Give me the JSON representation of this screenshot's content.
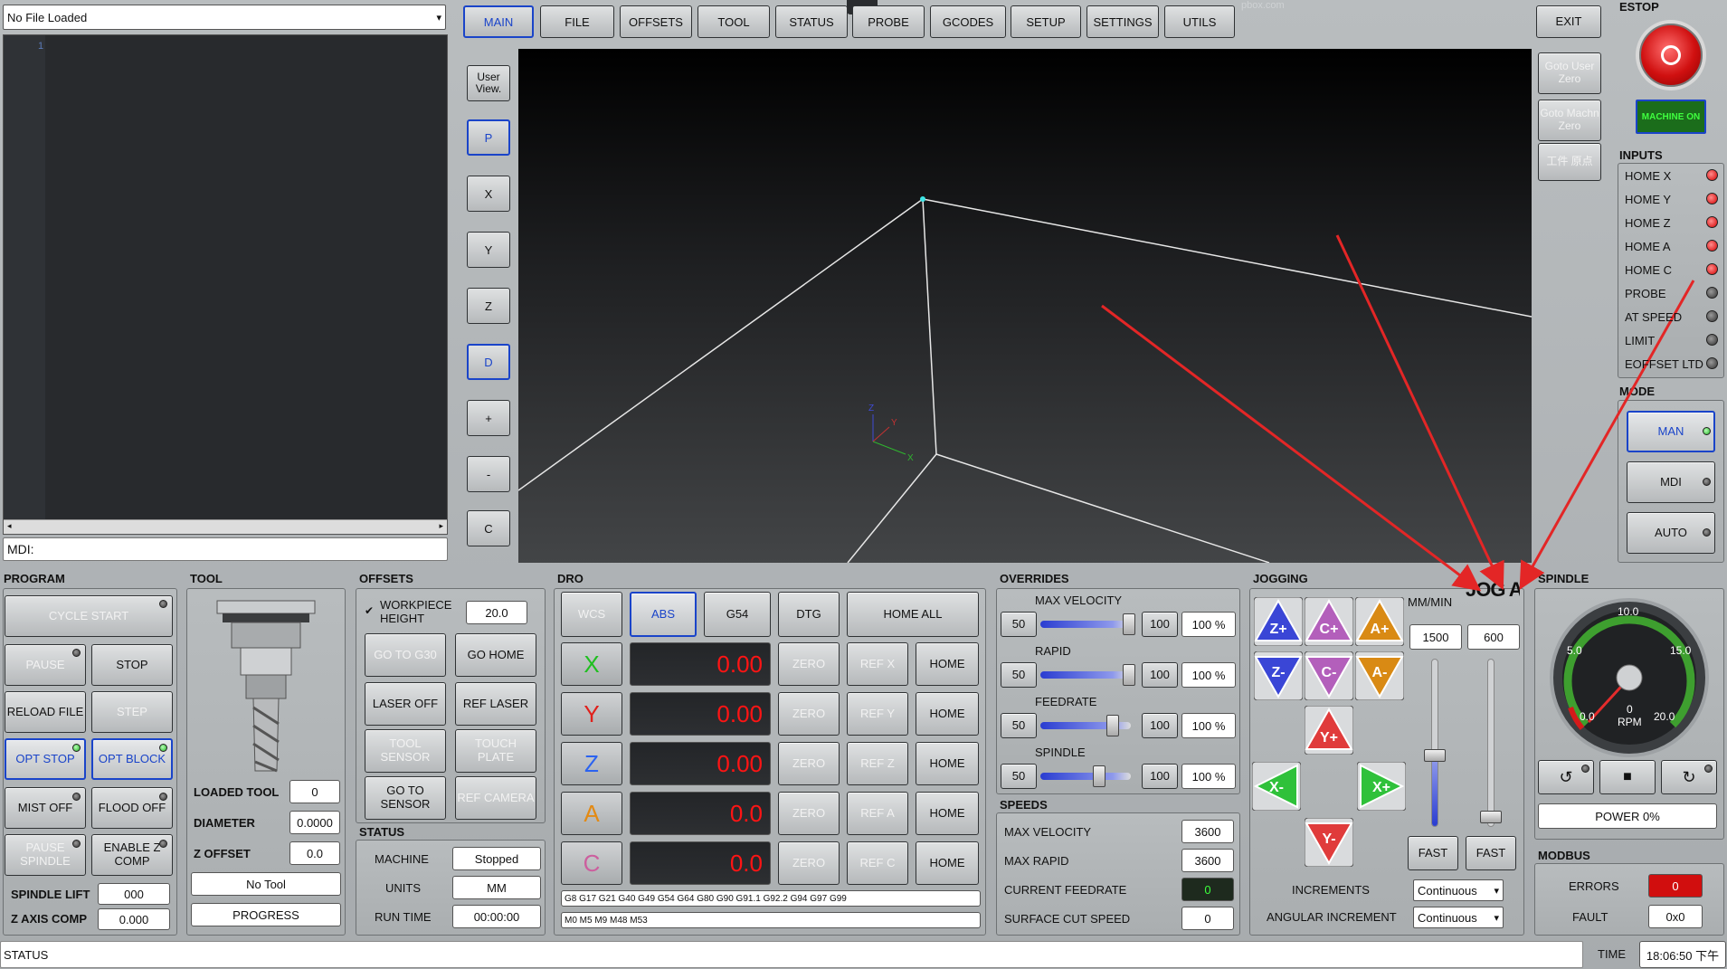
{
  "file_combo": {
    "value": "No File Loaded"
  },
  "editor": {
    "line": "1"
  },
  "mdi": {
    "label": "MDI:"
  },
  "tabs": [
    {
      "label": "MAIN"
    },
    {
      "label": "FILE"
    },
    {
      "label": "OFFSETS"
    },
    {
      "label": "TOOL"
    },
    {
      "label": "STATUS"
    },
    {
      "label": "PROBE"
    },
    {
      "label": "GCODES"
    },
    {
      "label": "SETUP"
    },
    {
      "label": "SETTINGS"
    },
    {
      "label": "UTILS"
    }
  ],
  "exit_label": "EXIT",
  "watermark": "pbox.com",
  "view_buttons": [
    {
      "label": "User View."
    },
    {
      "label": "P"
    },
    {
      "label": "X"
    },
    {
      "label": "Y"
    },
    {
      "label": "Z"
    },
    {
      "label": "D"
    },
    {
      "label": "+"
    },
    {
      "label": "-"
    },
    {
      "label": "C"
    }
  ],
  "goto_buttons": [
    {
      "label": "Goto User Zero"
    },
    {
      "label": "Goto Machn Zero"
    },
    {
      "label": "工件 原点"
    }
  ],
  "estop": {
    "title": "ESTOP",
    "machine_on": "MACHINE ON"
  },
  "inputs": {
    "title": "INPUTS",
    "items": [
      {
        "label": "HOME X",
        "state": "red"
      },
      {
        "label": "HOME Y",
        "state": "red"
      },
      {
        "label": "HOME Z",
        "state": "red"
      },
      {
        "label": "HOME A",
        "state": "red"
      },
      {
        "label": "HOME C",
        "state": "red"
      },
      {
        "label": "PROBE",
        "state": "off"
      },
      {
        "label": "AT SPEED",
        "state": "off"
      },
      {
        "label": "LIMIT",
        "state": "off"
      },
      {
        "label": "EOFFSET LTD",
        "state": "off"
      }
    ]
  },
  "mode": {
    "title": "MODE",
    "items": [
      {
        "label": "MAN"
      },
      {
        "label": "MDI"
      },
      {
        "label": "AUTO"
      }
    ]
  },
  "program": {
    "title": "PROGRAM",
    "cycle_start": "CYCLE START",
    "pause": "PAUSE",
    "stop": "STOP",
    "reload": "RELOAD FILE",
    "step": "STEP",
    "opt_stop": "OPT STOP",
    "opt_block": "OPT BLOCK",
    "mist": "MIST OFF",
    "flood": "FLOOD OFF",
    "pause_spindle": "PAUSE SPINDLE",
    "enable_z": "ENABLE Z COMP",
    "spindle_lift_label": "SPINDLE LIFT",
    "spindle_lift": "000",
    "z_axis_comp_label": "Z AXIS COMP",
    "z_axis_comp": "0.000"
  },
  "tool": {
    "title": "TOOL",
    "loaded_tool_label": "LOADED TOOL",
    "loaded_tool": "0",
    "diameter_label": "DIAMETER",
    "diameter": "0.0000",
    "z_offset_label": "Z OFFSET",
    "z_offset": "0.0",
    "no_tool": "No Tool",
    "progress": "PROGRESS"
  },
  "offsets": {
    "title": "OFFSETS",
    "workpiece_label": "WORKPIECE HEIGHT",
    "workpiece": "20.0",
    "go_to_g30": "GO TO G30",
    "go_home": "GO HOME",
    "laser_off": "LASER OFF",
    "ref_laser": "REF LASER",
    "tool_sensor": "TOOL SENSOR",
    "touch_plate": "TOUCH PLATE",
    "go_to_sensor": "GO TO SENSOR",
    "ref_camera": "REF CAMERA"
  },
  "status": {
    "title": "STATUS",
    "machine_label": "MACHINE",
    "machine": "Stopped",
    "units_label": "UNITS",
    "units": "MM",
    "run_time_label": "RUN TIME",
    "run_time": "00:00:00"
  },
  "dro": {
    "title": "DRO",
    "wcs": "WCS",
    "abs": "ABS",
    "g54": "G54",
    "dtg": "DTG",
    "home_all": "HOME ALL",
    "axes": [
      {
        "name": "X",
        "value": "0.00",
        "color": "#1fbf1f",
        "zero": "ZERO",
        "ref": "REF X",
        "home": "HOME"
      },
      {
        "name": "Y",
        "value": "0.00",
        "color": "#e0201b",
        "zero": "ZERO",
        "ref": "REF Y",
        "home": "HOME"
      },
      {
        "name": "Z",
        "value": "0.00",
        "color": "#2b63f0",
        "zero": "ZERO",
        "ref": "REF Z",
        "home": "HOME"
      },
      {
        "name": "A",
        "value": "0.0",
        "color": "#e38a14",
        "zero": "ZERO",
        "ref": "REF A",
        "home": "HOME"
      },
      {
        "name": "C",
        "value": "0.0",
        "color": "#cc5f9e",
        "zero": "ZERO",
        "ref": "REF C",
        "home": "HOME"
      }
    ],
    "gcodes": "G8 G17 G21 G40 G49 G54 G64 G80 G90 G91.1 G92.2 G94 G97 G99",
    "mcodes": "M0 M5 M9 M48 M53"
  },
  "overrides": {
    "title": "OVERRIDES",
    "rows": [
      {
        "label": "MAX VELOCITY",
        "low": "50",
        "high": "100",
        "value": "100 %",
        "fraction": 0.98
      },
      {
        "label": "RAPID",
        "low": "50",
        "high": "100",
        "value": "100 %",
        "fraction": 0.98
      },
      {
        "label": "FEEDRATE",
        "low": "50",
        "high": "100",
        "value": "100 %",
        "fraction": 0.8
      },
      {
        "label": "SPINDLE",
        "low": "50",
        "high": "100",
        "value": "100 %",
        "fraction": 0.65
      }
    ]
  },
  "speeds": {
    "title": "SPEEDS",
    "max_velocity_label": "MAX VELOCITY",
    "max_velocity": "3600",
    "max_rapid_label": "MAX RAPID",
    "max_rapid": "3600",
    "feedrate_label": "CURRENT FEEDRATE",
    "feedrate": "0",
    "surface_label": "SURFACE CUT SPEED",
    "surface": "0"
  },
  "jogging": {
    "title": "JOGGING",
    "units": "MM/MIN",
    "angular_title": "JOG ANGULAR",
    "linear_rate": "1500",
    "angular_rate": "600",
    "fast": "FAST",
    "fast2": "FAST",
    "increments_label": "INCREMENTS",
    "increments": "Continuous",
    "angular_increment_label": "ANGULAR INCREMENT",
    "angular_increment": "Continuous",
    "buttons": [
      {
        "label": "Z+",
        "color": "#3a46d6"
      },
      {
        "label": "C+",
        "color": "#b35fbb"
      },
      {
        "label": "A+",
        "color": "#d98a14"
      },
      {
        "label": "Z-",
        "color": "#3a46d6"
      },
      {
        "label": "C-",
        "color": "#b35fbb"
      },
      {
        "label": "A-",
        "color": "#d98a14"
      },
      {
        "label": "Y+",
        "color": "#e03b3b"
      },
      {
        "label": "X-",
        "color": "#2fc13a"
      },
      {
        "label": "X+",
        "color": "#2fc13a"
      },
      {
        "label": "Y-",
        "color": "#e03b3b"
      }
    ]
  },
  "spindle": {
    "title": "SPINDLE",
    "rpm_label": "RPM",
    "scale": [
      "0.0",
      "5.0",
      "10.0",
      "15.0",
      "20.0"
    ],
    "value": "0",
    "power": "POWER 0%"
  },
  "modbus": {
    "title": "MODBUS",
    "errors_label": "ERRORS",
    "errors": "0",
    "fault_label": "FAULT",
    "fault": "0x0"
  },
  "statusbar": {
    "status": "STATUS",
    "time_label": "TIME",
    "time": "18:06:50 下午"
  },
  "colors": {
    "accent": "#1a44c9",
    "red": "#e0201b",
    "green": "#1fbf1f",
    "annotation": "#e32626"
  }
}
